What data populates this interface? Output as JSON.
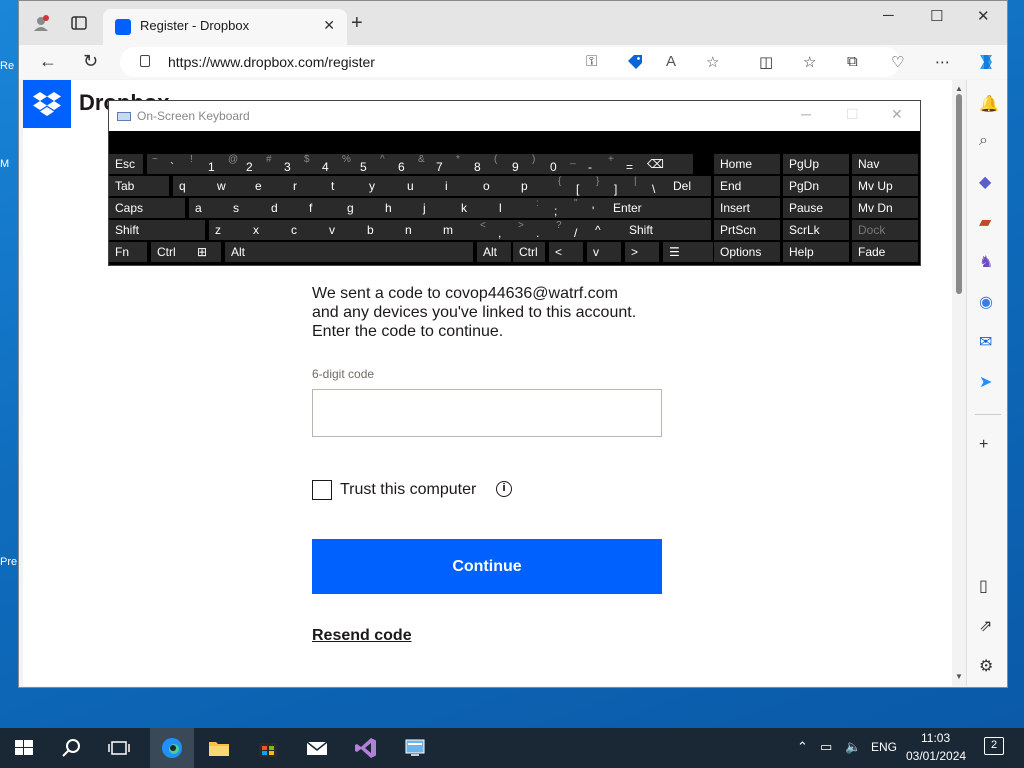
{
  "desktop": {
    "icon_labels": [
      "Re",
      "M",
      "Pre"
    ]
  },
  "browser": {
    "tab": {
      "title": "Register - Dropbox",
      "close": "✕"
    },
    "new_tab": "+",
    "window_controls": {
      "minimize": "─",
      "maximize": "☐",
      "close": "✕"
    },
    "nav": {
      "back": "←",
      "refresh": "↻"
    },
    "address": {
      "url": "https://www.dropbox.com/register"
    }
  },
  "page": {
    "brand": "Dropbox",
    "message_lines": [
      "We sent a code to covop44636@watrf.com",
      "and any devices you've linked to this account.",
      "Enter the code to continue."
    ],
    "code_field": {
      "label": "6-digit code",
      "value": ""
    },
    "trust": {
      "label": "Trust this computer",
      "info": "i",
      "checked": false
    },
    "continue_label": "Continue",
    "resend_label": "Resend code"
  },
  "osk": {
    "title": "On-Screen Keyboard",
    "controls": {
      "minimize": "─",
      "maximize": "☐",
      "close": "✕"
    },
    "keys": [
      [
        {
          "label": "Esc"
        },
        {
          "label": "`",
          "shift": "~"
        },
        {
          "label": "1",
          "shift": "!"
        },
        {
          "label": "2",
          "shift": "@"
        },
        {
          "label": "3",
          "shift": "#"
        },
        {
          "label": "4",
          "shift": "$"
        },
        {
          "label": "5",
          "shift": "%"
        },
        {
          "label": "6",
          "shift": "^"
        },
        {
          "label": "7",
          "shift": "&"
        },
        {
          "label": "8",
          "shift": "*"
        },
        {
          "label": "9",
          "shift": "("
        },
        {
          "label": "0",
          "shift": ")"
        },
        {
          "label": "-",
          "shift": "_"
        },
        {
          "label": "=",
          "shift": "+"
        },
        {
          "label": "⌫"
        },
        {
          "label": "Home"
        },
        {
          "label": "PgUp"
        },
        {
          "label": "Nav"
        }
      ],
      [
        {
          "label": "Tab"
        },
        {
          "label": "q"
        },
        {
          "label": "w"
        },
        {
          "label": "e"
        },
        {
          "label": "r"
        },
        {
          "label": "t"
        },
        {
          "label": "y"
        },
        {
          "label": "u"
        },
        {
          "label": "i"
        },
        {
          "label": "o"
        },
        {
          "label": "p"
        },
        {
          "label": "[",
          "shift": "{"
        },
        {
          "label": "]",
          "shift": "}"
        },
        {
          "label": "\\",
          "shift": "|"
        },
        {
          "label": "Del"
        },
        {
          "label": "End"
        },
        {
          "label": "PgDn"
        },
        {
          "label": "Mv Up"
        }
      ],
      [
        {
          "label": "Caps"
        },
        {
          "label": "a"
        },
        {
          "label": "s"
        },
        {
          "label": "d"
        },
        {
          "label": "f"
        },
        {
          "label": "g"
        },
        {
          "label": "h"
        },
        {
          "label": "j"
        },
        {
          "label": "k"
        },
        {
          "label": "l"
        },
        {
          "label": ";",
          "shift": ":"
        },
        {
          "label": "'",
          "shift": "\""
        },
        {
          "label": "Enter"
        },
        {
          "label": "Insert"
        },
        {
          "label": "Pause"
        },
        {
          "label": "Mv Dn"
        }
      ],
      [
        {
          "label": "Shift"
        },
        {
          "label": "z"
        },
        {
          "label": "x"
        },
        {
          "label": "c"
        },
        {
          "label": "v"
        },
        {
          "label": "b"
        },
        {
          "label": "n"
        },
        {
          "label": "m"
        },
        {
          "label": ",",
          "shift": "<"
        },
        {
          "label": ".",
          "shift": ">"
        },
        {
          "label": "/",
          "shift": "?"
        },
        {
          "label": "^"
        },
        {
          "label": "Shift"
        },
        {
          "label": "PrtScn"
        },
        {
          "label": "ScrLk"
        },
        {
          "label": "Dock"
        }
      ],
      [
        {
          "label": "Fn"
        },
        {
          "label": "Ctrl"
        },
        {
          "label": "⊞"
        },
        {
          "label": "Alt"
        },
        {
          "label": ""
        },
        {
          "label": "Alt"
        },
        {
          "label": "Ctrl"
        },
        {
          "label": "<"
        },
        {
          "label": "v"
        },
        {
          "label": ">"
        },
        {
          "label": "☰"
        },
        {
          "label": "Options"
        },
        {
          "label": "Help"
        },
        {
          "label": "Fade"
        }
      ]
    ]
  },
  "taskbar": {
    "time": "11:03",
    "date": "03/01/2024",
    "lang": "ENG",
    "notifications": "2"
  },
  "colors": {
    "accent": "#0061fe",
    "taskbar": "#1a2734",
    "desktop": "#0f6cbd"
  }
}
